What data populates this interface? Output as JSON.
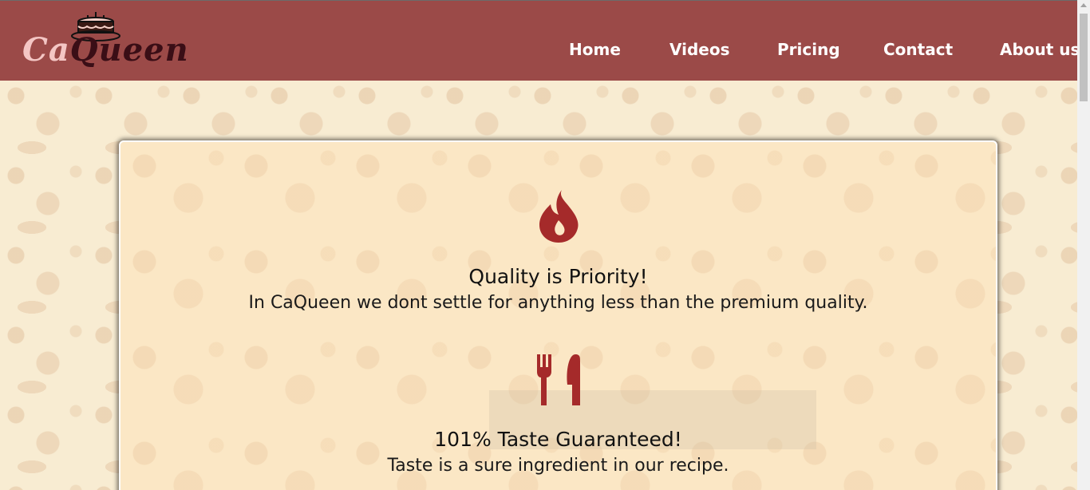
{
  "brand": {
    "prefix": "Ca",
    "suffix": "Queen"
  },
  "nav": {
    "items": [
      {
        "label": "Home"
      },
      {
        "label": "Videos"
      },
      {
        "label": "Pricing"
      },
      {
        "label": "Contact"
      },
      {
        "label": "About us"
      }
    ]
  },
  "features": [
    {
      "icon": "flame-icon",
      "title": "Quality is Priority!",
      "description": "In CaQueen we dont settle for anything less than the premium quality."
    },
    {
      "icon": "utensils-icon",
      "title": "101% Taste Guaranteed!",
      "description": "Taste is a sure ingredient in our recipe."
    }
  ],
  "colors": {
    "header_bg": "#9b4a48",
    "accent_icon": "#a52a2a",
    "logo_ca": "#f4c6c4",
    "logo_queen": "#3a0e16",
    "page_bg": "#f8ecd2",
    "card_bg": "#fbe7c5"
  }
}
